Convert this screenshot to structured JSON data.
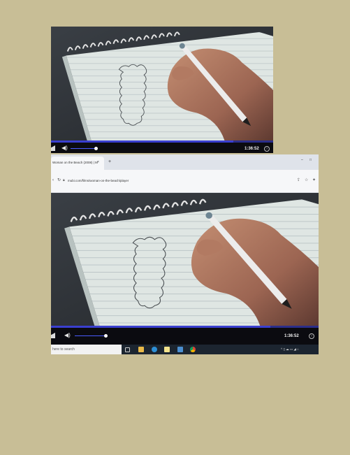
{
  "page": {
    "background": "#c8be96"
  },
  "top_screenshot": {
    "player": {
      "time": "1:36:52",
      "help_icon": "help-circle-icon",
      "volume_icon": "speaker-icon",
      "progress": 0.82,
      "volume": 1.0
    }
  },
  "bottom_screenshot": {
    "browser": {
      "tab_title": "Woman on the Beach (2008) | M",
      "tab_close": "×",
      "new_tab": "+",
      "url": "mubi.com/films/woman-on-the-beach/player",
      "window_buttons": [
        "–",
        "□"
      ]
    },
    "player": {
      "time": "1:36:52",
      "help_icon": "help-circle-icon",
      "volume_icon": "speaker-icon",
      "progress": 0.82,
      "volume": 1.0
    },
    "taskbar": {
      "search_placeholder": "here to search",
      "tray_text": "^ ▯ ☁ ▭ ◢ ⌂"
    }
  },
  "colors": {
    "progress_track": "#2b2e8a",
    "progress_fill": "#3a3fd0",
    "volume_track": "#4a5cff",
    "taskbar": "#1c2530"
  }
}
